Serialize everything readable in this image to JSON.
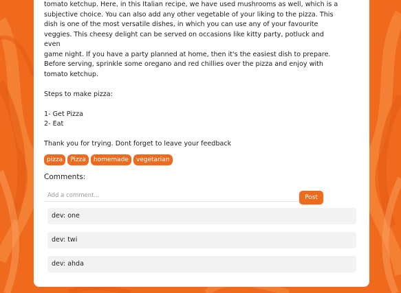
{
  "recipe": {
    "description": "tomato ketchup. Here, in this Italian recipe, we have used mushrooms as well, which is a\nsubjective choice. You can also add any other vegetable of your liking to the pizza. This\ndish is one of the most versatile dishes, in which you can use any of your favourite\nveggies. This cheesy delight can be served on occasions like kitty party, potluck and even\ngame night. If you have a party planned at home, then it's the easiest dish to prepare.\nBefore serving, sprinkle some oregano and red chillies over the pizza and enjoy with\ntomato ketchup.\n\nSteps to make pizza:\n\n1- Get Pizza\n2- Eat\n\nThank you for trying. Dont forget to leave your feedback"
  },
  "tags": [
    "pizza",
    "Pizza",
    "homemade",
    "vegetarian"
  ],
  "comments_section": {
    "title": "Comments:",
    "input_placeholder": "Add a comment...",
    "post_label": "Post",
    "items": [
      "dev: one",
      "dev: twi",
      "dev: ahda"
    ]
  },
  "colors": {
    "accent": "#ee6a1f",
    "background": "#f06a1e",
    "card": "#ffffff",
    "comment_bg": "#f2f2f2"
  }
}
